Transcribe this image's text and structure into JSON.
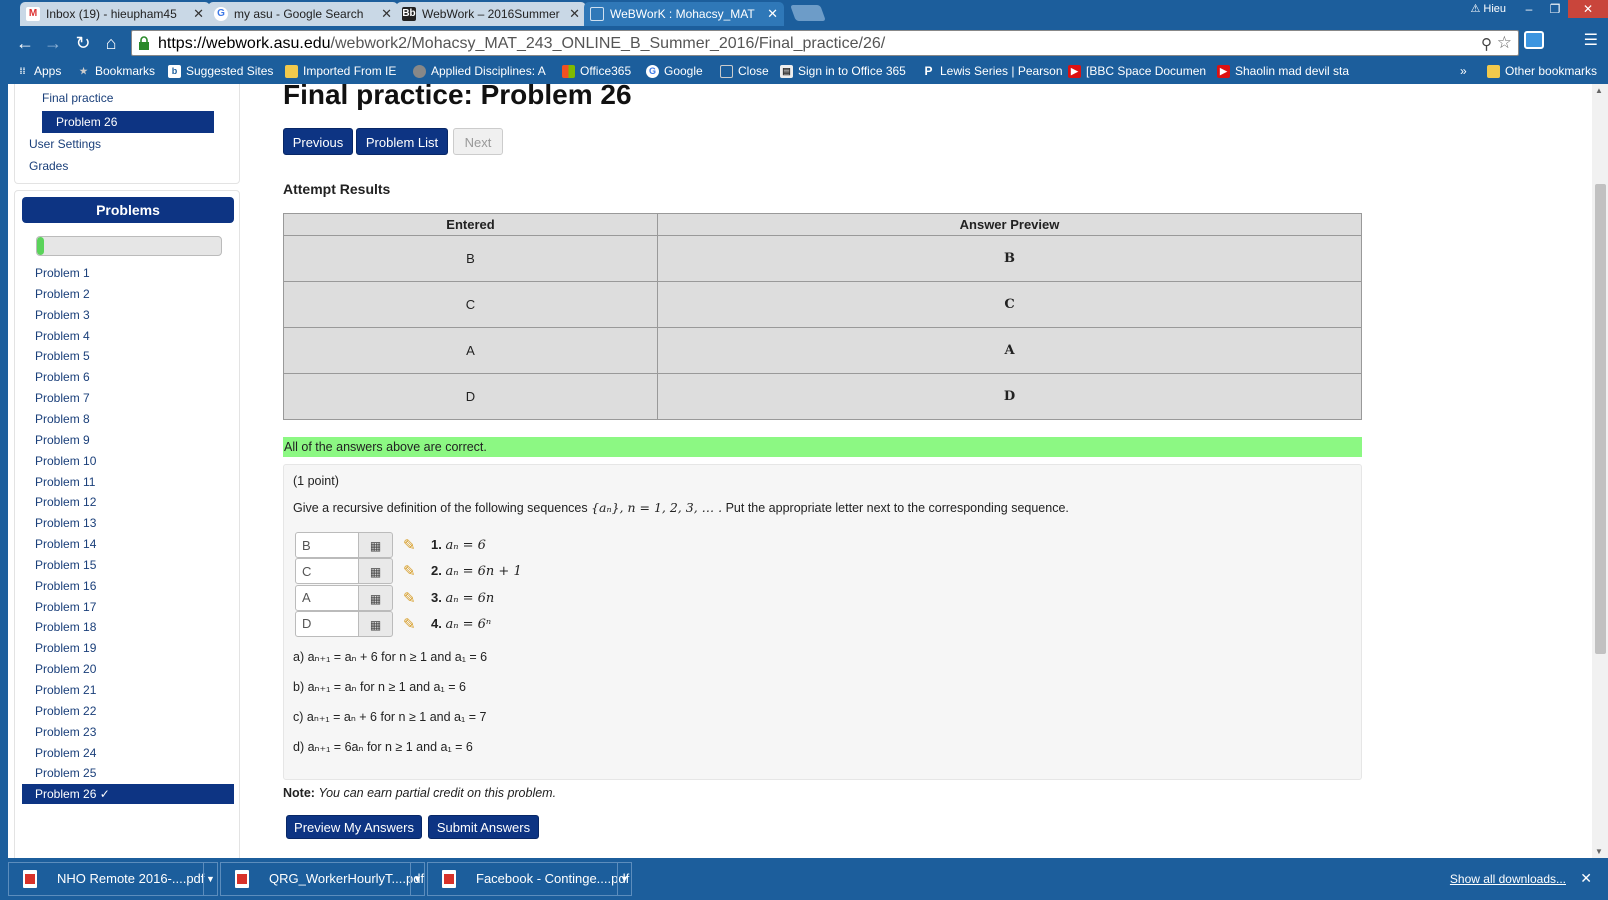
{
  "browser": {
    "tabs": [
      {
        "title": "Inbox (19) - hieupham45",
        "icon": "gmail-icon"
      },
      {
        "title": "my asu - Google Search",
        "icon": "google-icon"
      },
      {
        "title": "WebWork – 2016Summer",
        "icon": "blackboard-icon"
      },
      {
        "title": "WeBWorK : Mohacsy_MAT",
        "icon": "page-icon"
      }
    ],
    "user": "Hieu",
    "url_host": "https://webwork.asu.edu",
    "url_path": "/webwork2/Mohacsy_MAT_243_ONLINE_B_Summer_2016/Final_practice/26/",
    "bookmarks": [
      "Apps",
      "Bookmarks",
      "Suggested Sites",
      "Imported From IE",
      "Applied Disciplines: A",
      "Office365",
      "Google",
      "Close",
      "Sign in to Office 365",
      "Lewis Series | Pearson",
      "[BBC Space Documen",
      "Shaolin mad devil sta",
      "Other bookmarks"
    ]
  },
  "sidebar": {
    "final_practice": "Final practice",
    "active_item": "Problem 26",
    "user_settings": "User Settings",
    "grades": "Grades",
    "problems_header": "Problems",
    "progress_fraction": 0.04,
    "problems": [
      "Problem 1",
      "Problem 2",
      "Problem 3",
      "Problem 4",
      "Problem 5",
      "Problem 6",
      "Problem 7",
      "Problem 8",
      "Problem 9",
      "Problem 10",
      "Problem 11",
      "Problem 12",
      "Problem 13",
      "Problem 14",
      "Problem 15",
      "Problem 16",
      "Problem 17",
      "Problem 18",
      "Problem 19",
      "Problem 20",
      "Problem 21",
      "Problem 22",
      "Problem 23",
      "Problem 24",
      "Problem 25"
    ],
    "current_problem": "Problem 26 ✓"
  },
  "main": {
    "title": "Final practice: Problem 26",
    "previous_label": "Previous",
    "problem_list_label": "Problem List",
    "next_label": "Next",
    "attempt_results_heading": "Attempt Results",
    "table_headers": [
      "Entered",
      "Answer Preview"
    ],
    "table_rows": [
      [
        "B",
        "B"
      ],
      [
        "C",
        "C"
      ],
      [
        "A",
        "A"
      ],
      [
        "D",
        "D"
      ]
    ],
    "correct_message": "All of the answers above are correct.",
    "points": "(1 point)",
    "question_prefix": "Give a recursive definition of the following sequences",
    "question_math": "{aₙ}, n = 1, 2, 3, … .",
    "question_suffix": "Put the appropriate letter next to the corresponding sequence.",
    "answers": [
      {
        "value": "B",
        "label": "1.",
        "expr": "aₙ = 6"
      },
      {
        "value": "C",
        "label": "2.",
        "expr": "aₙ = 6n + 1"
      },
      {
        "value": "A",
        "label": "3.",
        "expr": "aₙ = 6n"
      },
      {
        "value": "D",
        "label": "4.",
        "expr": "aₙ = 6ⁿ"
      }
    ],
    "options": [
      "a)  aₙ₊₁ = aₙ + 6  for  n ≥ 1  and  a₁ = 6",
      "b)  aₙ₊₁ = aₙ  for  n ≥ 1  and  a₁ = 6",
      "c)  aₙ₊₁ = aₙ + 6  for  n ≥ 1  and  a₁ = 7",
      "d)  aₙ₊₁ = 6aₙ  for  n ≥ 1  and  a₁ = 6"
    ],
    "note_label": "Note:",
    "note_text": "You can earn partial credit on this problem.",
    "preview_label": "Preview My Answers",
    "submit_label": "Submit Answers"
  },
  "downloads": {
    "items": [
      "NHO Remote 2016-....pdf",
      "QRG_WorkerHourlyT....pdf",
      "Facebook - Continge....pdf"
    ],
    "show_all": "Show all downloads..."
  },
  "colors": {
    "chrome": "#1c5e9c",
    "button": "#0d3483",
    "success": "#8cf883"
  }
}
